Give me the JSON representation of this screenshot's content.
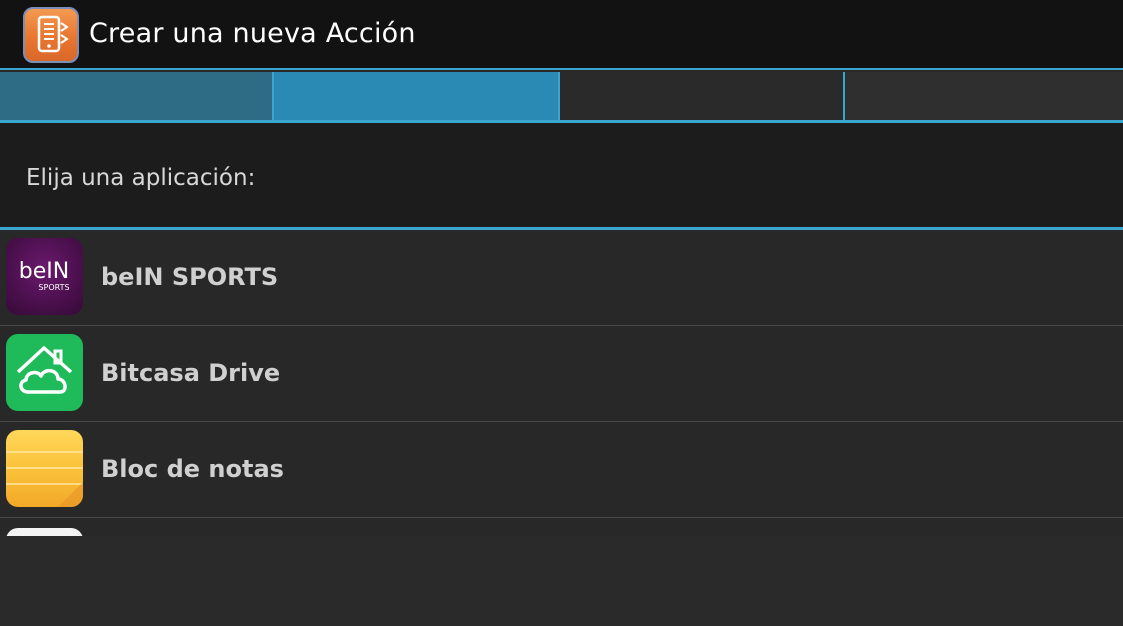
{
  "header": {
    "title": "Crear una nueva Acción",
    "app_icon": "task-app-icon"
  },
  "wizard": {
    "steps": [
      {
        "state": "completed"
      },
      {
        "state": "active"
      },
      {
        "state": "pending"
      },
      {
        "state": "pending"
      }
    ],
    "colors": {
      "accent": "#3aa6d0",
      "completed": "#2e6b84",
      "active": "#2b8ab3",
      "pending": "#2a2a2a"
    }
  },
  "prompt": "Elija una aplicación:",
  "apps": [
    {
      "label": "beIN SPORTS",
      "icon": "bein-sports-icon"
    },
    {
      "label": "Bitcasa Drive",
      "icon": "bitcasa-drive-icon"
    },
    {
      "label": "Bloc de notas",
      "icon": "notepad-icon"
    },
    {
      "label": "",
      "icon": "app-icon"
    }
  ],
  "icon_text": {
    "bein_wordmark": "beIN",
    "bein_sub": "SPORTS"
  }
}
